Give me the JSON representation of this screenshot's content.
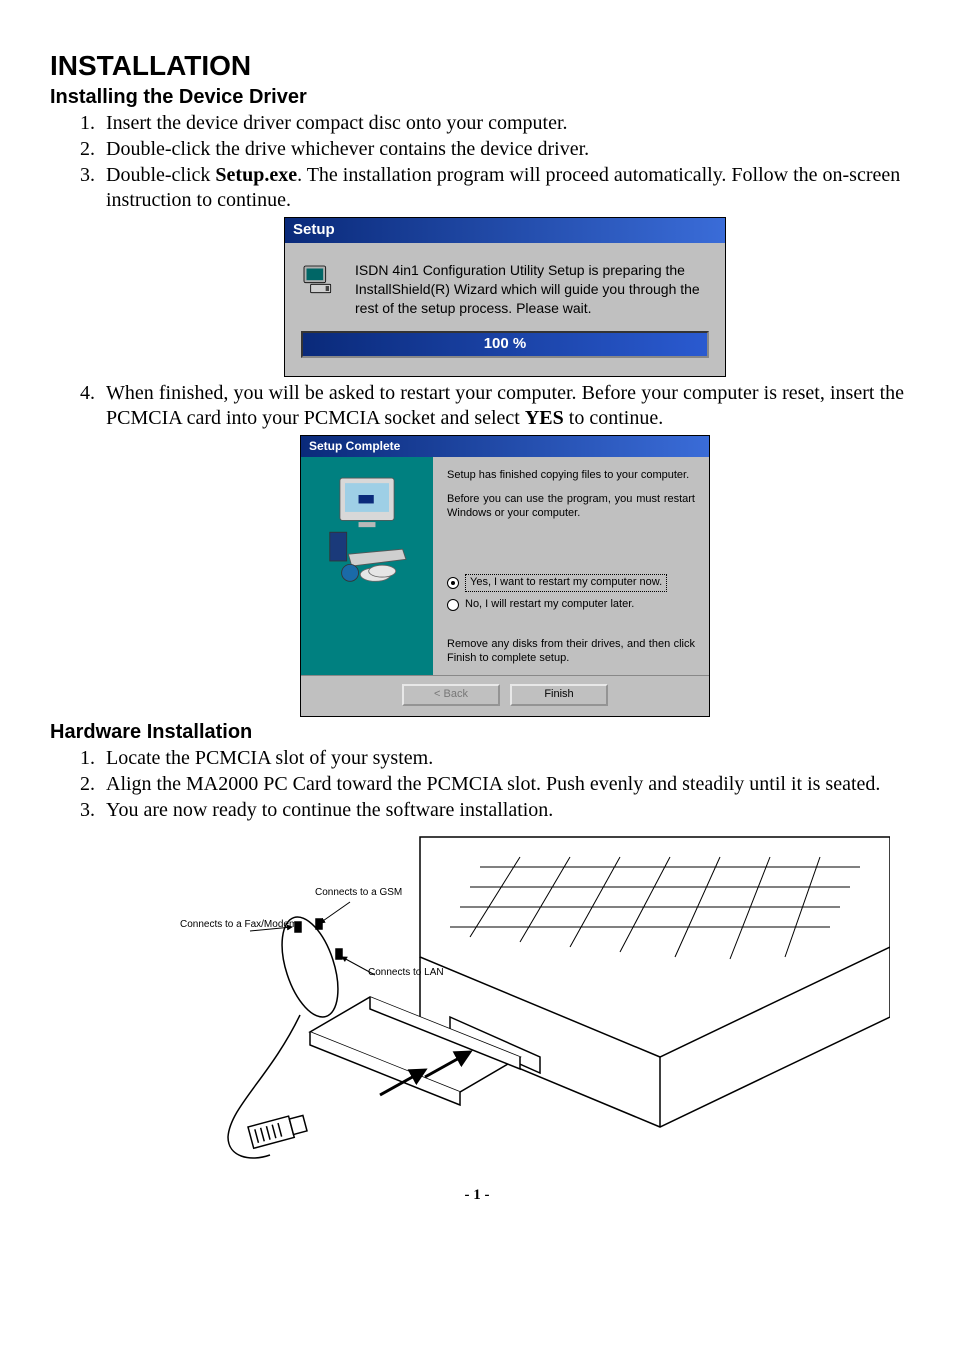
{
  "headings": {
    "title": "INSTALLATION",
    "sub1": "Installing the Device Driver",
    "sub2": "Hardware Installation"
  },
  "driver_steps": {
    "s1": "Insert the device driver compact disc onto your computer.",
    "s2": "Double-click the drive whichever contains the device driver.",
    "s3a": "Double-click ",
    "s3b": "Setup.exe",
    "s3c": ". The installation program will proceed automatically. Follow the on-screen instruction to continue.",
    "s4a": "When finished, you will be asked to restart your computer. Before your computer is reset, insert the PCMCIA card into your PCMCIA socket and select ",
    "s4b": "YES",
    "s4c": " to continue."
  },
  "setup_dialog1": {
    "title": "Setup",
    "body": "ISDN 4in1 Configuration Utility Setup is preparing the InstallShield(R) Wizard which will guide you through the rest of the setup process.  Please wait.",
    "progress": "100 %"
  },
  "setup_dialog2": {
    "title": "Setup Complete",
    "line1": "Setup has finished copying files to your computer.",
    "line2": "Before you can use the program, you must restart Windows or your computer.",
    "radio_yes": "Yes, I want to restart my computer now.",
    "radio_no": "No, I will restart my computer later.",
    "note": "Remove any disks from their drives, and then click Finish to complete setup.",
    "btn_back": "< Back",
    "btn_finish": "Finish"
  },
  "hardware_steps": {
    "s1": "Locate the PCMCIA slot of your system.",
    "s2": "Align the MA2000 PC Card toward the PCMCIA slot. Push evenly and steadily until it is seated.",
    "s3": "You are now ready to continue the software installation."
  },
  "hw_labels": {
    "gsm": "Connects to a GSM",
    "fax": "Connects to a Fax/Modem",
    "lan": "Connects to LAN"
  },
  "page_number": "- 1 -"
}
